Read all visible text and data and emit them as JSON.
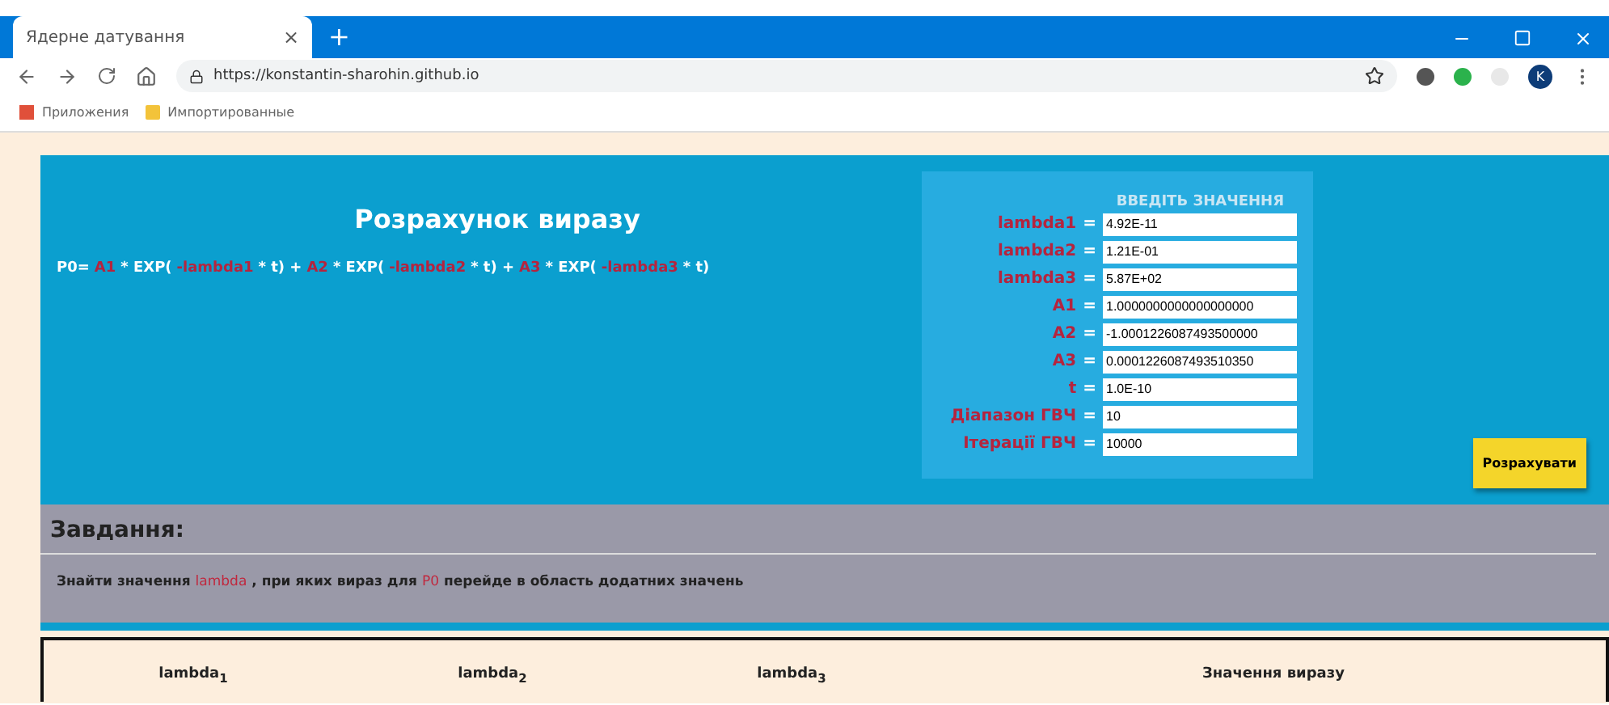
{
  "browser": {
    "tab_title": "Ядерне датування",
    "new_tab": "+",
    "tab_close": "×",
    "url": "https://konstantin-sharohin.github.io",
    "bookmarks": [
      "Приложения",
      "Импортированные"
    ],
    "profile_initial": "K"
  },
  "calc": {
    "title": "Розрахунок виразу",
    "formula": [
      {
        "kind": "op",
        "text": "P0="
      },
      {
        "kind": "var",
        "text": "A1"
      },
      {
        "kind": "op",
        "text": "* EXP("
      },
      {
        "kind": "var",
        "text": "-lambda1"
      },
      {
        "kind": "op",
        "text": "* t) +"
      },
      {
        "kind": "var",
        "text": "A2"
      },
      {
        "kind": "op",
        "text": "* EXP("
      },
      {
        "kind": "var",
        "text": "-lambda2"
      },
      {
        "kind": "op",
        "text": "* t) +"
      },
      {
        "kind": "var",
        "text": "A3"
      },
      {
        "kind": "op",
        "text": "* EXP("
      },
      {
        "kind": "var",
        "text": "-lambda3"
      },
      {
        "kind": "op",
        "text": "* t)"
      }
    ],
    "form_title": "ВВЕДІТЬ ЗНАЧЕННЯ",
    "fields": [
      {
        "label": "lambda1",
        "eq": "=",
        "value": "4.92E-11"
      },
      {
        "label": "lambda2",
        "eq": "=",
        "value": "1.21E-01"
      },
      {
        "label": "lambda3",
        "eq": "=",
        "value": "5.87E+02"
      },
      {
        "label": "A1",
        "eq": "=",
        "value": "1.0000000000000000000"
      },
      {
        "label": "A2",
        "eq": "=",
        "value": "-1.0001226087493500000"
      },
      {
        "label": "A3",
        "eq": "=",
        "value": "0.0001226087493510350"
      },
      {
        "label": "t",
        "eq": "=",
        "value": "1.0E-10"
      },
      {
        "label": "Діапазон ГВЧ",
        "eq": "=",
        "value": "10"
      },
      {
        "label": "Ітерації ГВЧ",
        "eq": "=",
        "value": "10000"
      }
    ],
    "button": "Розрахувати"
  },
  "task": {
    "title": "Завдання:",
    "sentence": [
      {
        "kind": "text",
        "text": "Знайти значення"
      },
      {
        "kind": "var",
        "text": "lambda"
      },
      {
        "kind": "text",
        "text": ", при яких вираз для"
      },
      {
        "kind": "var",
        "text": "P0"
      },
      {
        "kind": "text",
        "text": "перейде в область додатних значень"
      }
    ]
  },
  "table": {
    "columns": [
      "lambda$_{1}$",
      "lambda$_{2}$",
      "lambda$_{3}$",
      "Значення виразу"
    ]
  }
}
